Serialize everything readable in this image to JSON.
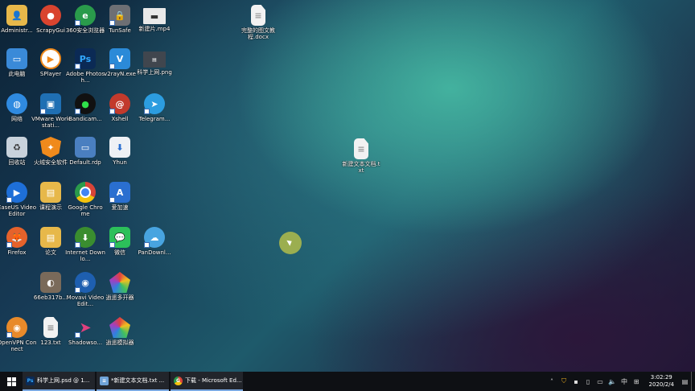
{
  "desktop": {
    "icons": [
      {
        "label": "Administr...",
        "bg": "#e7b84a"
      },
      {
        "label": "ScrapyGui",
        "bg": "#d9442f"
      },
      {
        "label": "360安全浏览器",
        "bg": "#2a9b4b"
      },
      {
        "label": "TunSafe",
        "bg": "#6d6f74"
      },
      {
        "label": "新建片.mp4",
        "bg": "#e9e9e9"
      },
      {
        "label": "此电脑",
        "bg": "#3a8ad8"
      },
      {
        "label": "SPlayer",
        "bg": "#f08a1c"
      },
      {
        "label": "Adobe Photosh...",
        "bg": "#0b2a55",
        "glyph": "Ps"
      },
      {
        "label": "v2rayN.exe",
        "bg": "#2b8ad8",
        "glyph": "V"
      },
      {
        "label": "科学上网.png",
        "bg": "#40464e"
      },
      {
        "label": "网络",
        "bg": "#2f8ae0"
      },
      {
        "label": "VMware Workstati...",
        "bg": "#1f6fb3"
      },
      {
        "label": "Bandicam...",
        "bg": "#111",
        "glyph": "●"
      },
      {
        "label": "Xshell",
        "bg": "#c23a2c",
        "glyph": "@"
      },
      {
        "label": "Telegram...",
        "bg": "#2c9de0",
        "glyph": "➤"
      },
      {
        "label": "回收站",
        "bg": "#c8d2dc"
      },
      {
        "label": "火绒安全软件",
        "bg": "#f08a1c"
      },
      {
        "label": "Default.rdp",
        "bg": "#4a7fc0"
      },
      {
        "label": "Yhun",
        "bg": "#eef1f5",
        "glyph": "⬇"
      },
      {
        "label": "EaseUS Video Editor",
        "bg": "#1e6fd8"
      },
      {
        "label": "课程演示",
        "bg": "#e7b84a"
      },
      {
        "label": "Google Chrome",
        "bg": "#d84438"
      },
      {
        "label": "爱加速",
        "bg": "#2a6fd0",
        "glyph": "A"
      },
      {
        "label": "Firefox",
        "bg": "#e5622b"
      },
      {
        "label": "论文",
        "bg": "#e7b84a"
      },
      {
        "label": "Internet Downlo...",
        "bg": "#3a8d2f"
      },
      {
        "label": "微信",
        "bg": "#2cc05a"
      },
      {
        "label": "PanDownl...",
        "bg": "#48a4e0"
      },
      {
        "label": "66eb317b...",
        "bg": "#7a6a5a"
      },
      {
        "label": "Movavi Video Edit...",
        "bg": "#1e5fb0"
      },
      {
        "label": "逍遥多开器",
        "bg": "#7a3fc0"
      },
      {
        "label": "OpenVPN Connect",
        "bg": "#e88a2a"
      },
      {
        "label": "123.txt",
        "bg": "#f2f2f2"
      },
      {
        "label": "Shadowso...",
        "bg": "#c0306e"
      },
      {
        "label": "逍遥模拟器",
        "bg": "#8a3fc0"
      }
    ],
    "file1": {
      "label": "完整的图文教程.docx"
    },
    "file2": {
      "label": "新建文本文档.txt"
    }
  },
  "taskbar": {
    "items": [
      {
        "label": "科学上网.psd @ 1...",
        "icon": "Ps"
      },
      {
        "label": "*新建文本文档.txt ...",
        "icon": "≡"
      },
      {
        "label": "下载 - Microsoft Ed...",
        "icon": "G"
      }
    ],
    "time": "3:02:29",
    "date": "2020/2/4",
    "ime": "中"
  }
}
